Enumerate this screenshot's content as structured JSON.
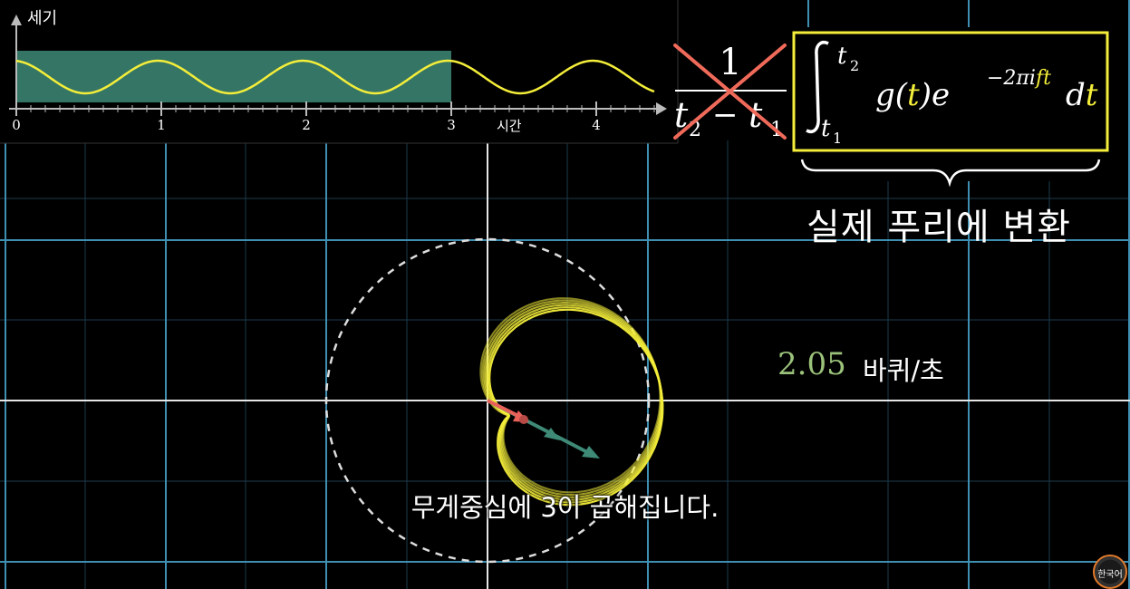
{
  "graph": {
    "y_label": "세기",
    "x_label": "시간",
    "x_ticks": [
      "0",
      "1",
      "2",
      "3",
      "4"
    ],
    "highlight_range": [
      0,
      3
    ],
    "signal_color": "#f4ee3a",
    "highlight_color": "#3e8a77"
  },
  "formula": {
    "fraction_numerator": "1",
    "fraction_denominator_left": "t",
    "fraction_denominator_left_sub": "2",
    "fraction_minus": "−",
    "fraction_denominator_right": "t",
    "fraction_denominator_right_sub": "1",
    "integral_upper": "t",
    "integral_upper_sub": "2",
    "integral_lower": "t",
    "integral_lower_sub": "1",
    "integrand_g": "g(",
    "integrand_t": "t",
    "integrand_close": ")e",
    "exponent_prefix": "−2πi",
    "exponent_f": "f",
    "exponent_t": "t",
    "differential_d": "d",
    "differential_t": "t",
    "box_color": "#f4ee3a",
    "cross_color": "#f06a5a",
    "brace_label": "실제 푸리에 변환"
  },
  "winding": {
    "frequency_value": "2.05",
    "frequency_unit": "바퀴/초",
    "curve_color": "#f4ee3a",
    "arrow_red_color": "#e8625a",
    "arrow_teal_color": "#3e8a77"
  },
  "subtitle": "무게중심에 3이 곱해집니다.",
  "badge": {
    "label": "한국어",
    "color": "#e07a2b"
  }
}
